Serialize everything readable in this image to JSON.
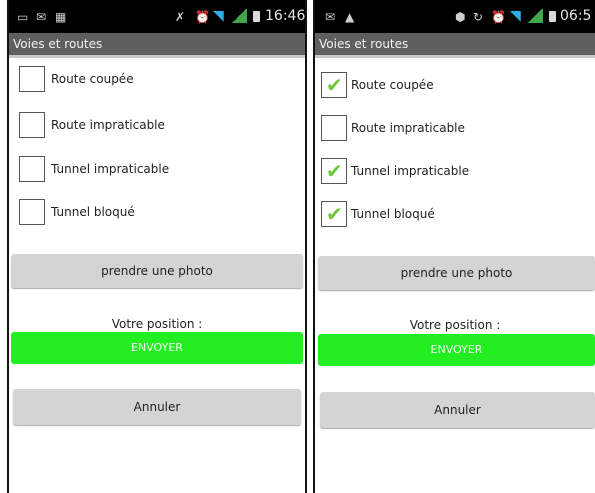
{
  "left": {
    "status": {
      "time": "16:46"
    },
    "title": "Voies et routes",
    "items": [
      {
        "label": "Route coupée",
        "checked": false
      },
      {
        "label": "Route impraticable",
        "checked": false
      },
      {
        "label": "Tunnel impraticable",
        "checked": false
      },
      {
        "label": "Tunnel bloqué",
        "checked": false
      }
    ],
    "photo_button": "prendre une photo",
    "position_label": "Votre position :",
    "send_button": "ENVOYER",
    "cancel_button": "Annuler"
  },
  "right": {
    "status": {
      "time": "06:5"
    },
    "title": "Voies et routes",
    "items": [
      {
        "label": "Route coupée",
        "checked": true
      },
      {
        "label": "Route impraticable",
        "checked": false
      },
      {
        "label": "Tunnel impraticable",
        "checked": true
      },
      {
        "label": "Tunnel bloqué",
        "checked": true
      }
    ],
    "photo_button": "prendre une photo",
    "position_label": "Votre position :",
    "send_button": "ENVOYER",
    "cancel_button": "Annuler"
  },
  "colors": {
    "send": "#22ee22",
    "check": "#6cc63a",
    "titlebar": "#5f5f5f"
  },
  "icons": {
    "check": "check-icon"
  }
}
